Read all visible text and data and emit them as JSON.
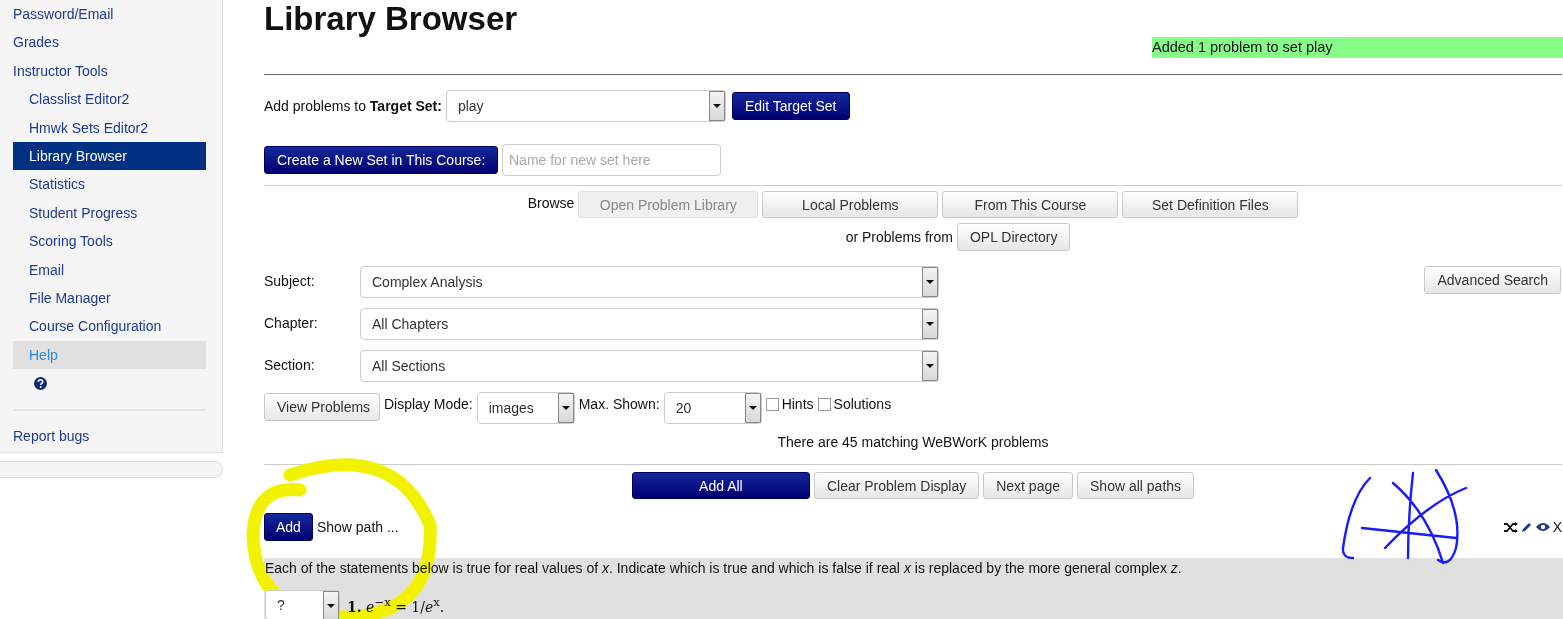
{
  "sidebar": {
    "items": [
      {
        "label": "Password/Email",
        "selected": false,
        "hovered": false
      },
      {
        "label": "Grades",
        "selected": false,
        "hovered": false
      },
      {
        "label": "Instructor Tools",
        "selected": false,
        "hovered": false,
        "children": [
          {
            "label": "Classlist Editor2",
            "selected": false,
            "hovered": false
          },
          {
            "label": "Hmwk Sets Editor2",
            "selected": false,
            "hovered": false
          },
          {
            "label": "Library Browser",
            "selected": true,
            "hovered": false
          },
          {
            "label": "Statistics",
            "selected": false,
            "hovered": false
          },
          {
            "label": "Student Progress",
            "selected": false,
            "hovered": false
          },
          {
            "label": "Scoring Tools",
            "selected": false,
            "hovered": false
          },
          {
            "label": "Email",
            "selected": false,
            "hovered": false
          },
          {
            "label": "File Manager",
            "selected": false,
            "hovered": false
          },
          {
            "label": "Course Configuration",
            "selected": false,
            "hovered": false
          },
          {
            "label": "Help",
            "selected": false,
            "hovered": true
          }
        ]
      }
    ],
    "footer_link": "Report bugs"
  },
  "page_title": "Library Browser",
  "message": "Added 1 problem to set play",
  "target_set": {
    "label": "Add problems to **Target Set:**",
    "value": "play",
    "button": "Edit Target Set"
  },
  "new_set": {
    "button": "Create a New Set in This Course:",
    "placeholder": "Name for new set here"
  },
  "browse": {
    "label": "Browse",
    "tabs": [
      {
        "label": "Open Problem Library",
        "selected": true
      },
      {
        "label": "Local Problems",
        "selected": false
      },
      {
        "label": "From This Course",
        "selected": false
      },
      {
        "label": "Set Definition Files",
        "selected": false
      }
    ],
    "or_label": "or Problems from",
    "directory_button": "OPL Directory"
  },
  "filters": [
    {
      "label": "Subject:",
      "value": "Complex Analysis"
    },
    {
      "label": "Chapter:",
      "value": "All Chapters"
    },
    {
      "label": "Section:",
      "value": "All Sections"
    }
  ],
  "advanced_search": "Advanced Search",
  "view": {
    "button": "View Problems",
    "display_mode_label": "Display Mode:",
    "display_mode": "images",
    "max_label": "Max. Shown:",
    "max_shown": "20",
    "options": [
      {
        "label": "Hints",
        "checked": false
      },
      {
        "label": "Solutions",
        "checked": false
      }
    ]
  },
  "match_count": "There are 45 matching WeBWorK problems",
  "actions": [
    {
      "label": "Add All",
      "kind": "primary"
    },
    {
      "label": "Clear Problem Display",
      "kind": "default"
    },
    {
      "label": "Next page",
      "kind": "default"
    },
    {
      "label": "Show all paths",
      "kind": "default"
    }
  ],
  "problem": {
    "add_button": "Add",
    "show_path": "Show path ...",
    "close": "X",
    "statement": "Each of the statements below is true for real values of *x*. Indicate which is true and which is false if real *x* is replaced by the more general complex *z*.",
    "answer": "?",
    "item": "**1.** *e*$^{−x}$ = 1/*e*$^{x}$."
  }
}
